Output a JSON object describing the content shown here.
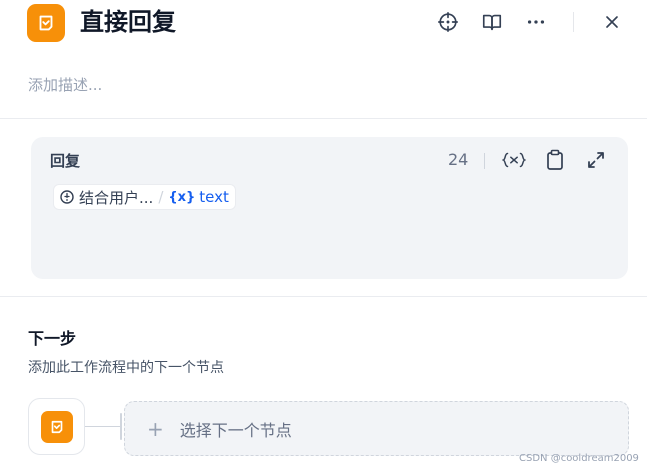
{
  "header": {
    "title": "直接回复",
    "description_placeholder": "添加描述...",
    "icons": [
      "crosshair-icon",
      "book-icon",
      "more-icon",
      "close-icon"
    ]
  },
  "reply": {
    "label": "回复",
    "char_count": "24",
    "variable": {
      "node": "结合用户...",
      "separator": "/",
      "var_icon": "{x}",
      "name": "text"
    }
  },
  "next_step": {
    "title": "下一步",
    "description": "添加此工作流程中的下一个节点",
    "select_plus": "+",
    "select_label": "选择下一个节点"
  },
  "watermark": "CSDN @cooldream2009",
  "colors": {
    "brand_orange": "#f79009",
    "variable_blue": "#155eef",
    "card_bg": "#f2f4f7"
  }
}
